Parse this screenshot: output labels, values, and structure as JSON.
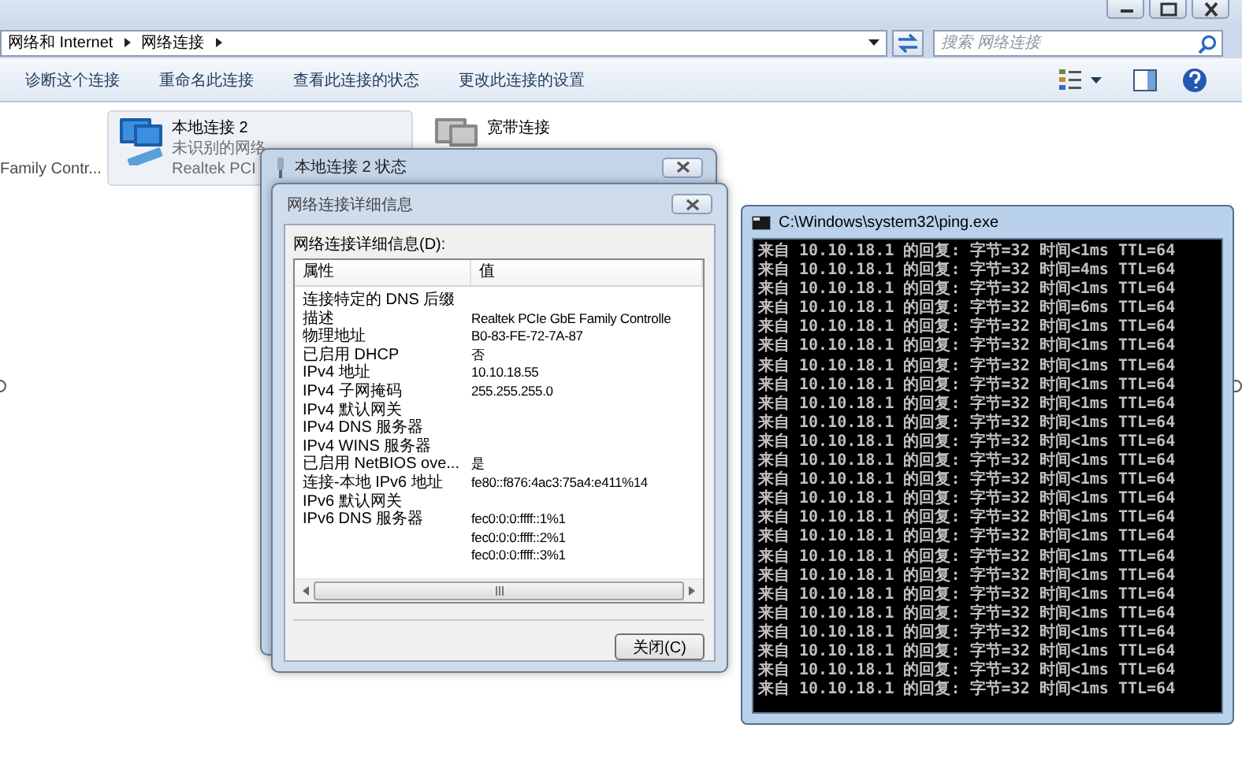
{
  "window": {
    "breadcrumb": [
      "网络和 Internet",
      "网络连接"
    ],
    "search": {
      "placeholder": "搜索 网络连接"
    }
  },
  "toolbar": [
    "诊断这个连接",
    "重命名此连接",
    "查看此连接的状态",
    "更改此连接的设置"
  ],
  "partial_connection": {
    "device": "Family Contr..."
  },
  "connections": [
    {
      "name": "本地连接 2",
      "status": "未识别的网络",
      "device": "Realtek PCI",
      "selected": true
    },
    {
      "name": "宽带连接",
      "selected": false
    }
  ],
  "status_dialog": {
    "title": "本地连接 2 状态"
  },
  "details_dialog": {
    "title": "网络连接详细信息",
    "list_label": "网络连接详细信息(D):",
    "columns": [
      "属性",
      "值"
    ],
    "rows": [
      {
        "property": "连接特定的 DNS 后缀"
      },
      {
        "property": "描述",
        "value": "Realtek PCIe GbE Family Controlle"
      },
      {
        "property": "物理地址",
        "value": "B0-83-FE-72-7A-87"
      },
      {
        "property": "已启用 DHCP",
        "value": "否"
      },
      {
        "property": "IPv4 地址",
        "value": "10.10.18.55"
      },
      {
        "property": "IPv4 子网掩码",
        "value": "255.255.255.0"
      },
      {
        "property": "IPv4 默认网关"
      },
      {
        "property": "IPv4 DNS 服务器"
      },
      {
        "property": "IPv4 WINS 服务器"
      },
      {
        "property": "已启用 NetBIOS ove...",
        "value": "是"
      },
      {
        "property": "连接-本地 IPv6 地址",
        "value": "fe80::f876:4ac3:75a4:e411%14"
      },
      {
        "property": "IPv6 默认网关"
      },
      {
        "property": "IPv6 DNS 服务器",
        "value": "fec0:0:0:ffff::1%1"
      },
      {
        "value": "fec0:0:0:ffff::2%1"
      },
      {
        "value": "fec0:0:0:ffff::3%1"
      }
    ],
    "close_button": "关闭(C)"
  },
  "console": {
    "title": "C:\\Windows\\system32\\ping.exe",
    "lines": [
      "来自 10.10.18.1 的回复: 字节=32 时间<1ms TTL=64",
      "来自 10.10.18.1 的回复: 字节=32 时间=4ms TTL=64",
      "来自 10.10.18.1 的回复: 字节=32 时间<1ms TTL=64",
      "来自 10.10.18.1 的回复: 字节=32 时间=6ms TTL=64",
      "来自 10.10.18.1 的回复: 字节=32 时间<1ms TTL=64",
      "来自 10.10.18.1 的回复: 字节=32 时间<1ms TTL=64",
      "来自 10.10.18.1 的回复: 字节=32 时间<1ms TTL=64",
      "来自 10.10.18.1 的回复: 字节=32 时间<1ms TTL=64",
      "来自 10.10.18.1 的回复: 字节=32 时间<1ms TTL=64",
      "来自 10.10.18.1 的回复: 字节=32 时间<1ms TTL=64",
      "来自 10.10.18.1 的回复: 字节=32 时间<1ms TTL=64",
      "来自 10.10.18.1 的回复: 字节=32 时间<1ms TTL=64",
      "来自 10.10.18.1 的回复: 字节=32 时间<1ms TTL=64",
      "来自 10.10.18.1 的回复: 字节=32 时间<1ms TTL=64",
      "来自 10.10.18.1 的回复: 字节=32 时间<1ms TTL=64",
      "来自 10.10.18.1 的回复: 字节=32 时间<1ms TTL=64",
      "来自 10.10.18.1 的回复: 字节=32 时间<1ms TTL=64",
      "来自 10.10.18.1 的回复: 字节=32 时间<1ms TTL=64",
      "来自 10.10.18.1 的回复: 字节=32 时间<1ms TTL=64",
      "来自 10.10.18.1 的回复: 字节=32 时间<1ms TTL=64",
      "来自 10.10.18.1 的回复: 字节=32 时间<1ms TTL=64",
      "来自 10.10.18.1 的回复: 字节=32 时间<1ms TTL=64",
      "来自 10.10.18.1 的回复: 字节=32 时间<1ms TTL=64",
      "来自 10.10.18.1 的回复: 字节=32 时间<1ms TTL=64"
    ]
  }
}
